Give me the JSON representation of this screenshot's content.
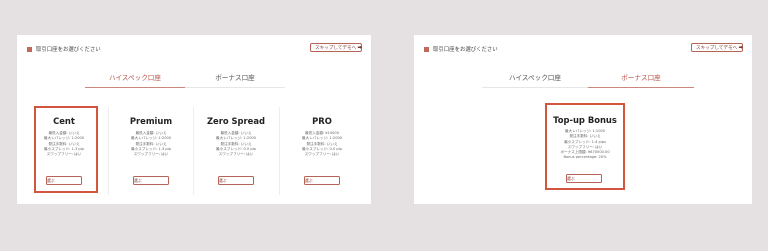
{
  "left": {
    "header_title": "取引口座をお選びください",
    "skip_label": "スキップしてデモへ ⮕",
    "tabs": [
      {
        "label": "ハイスペック口座",
        "active": true
      },
      {
        "label": "ボーナス口座",
        "active": false
      }
    ],
    "cards": [
      {
        "title": "Cent",
        "lines": [
          "最低入金額: いいえ",
          "最大レバレッジ: 1:2000",
          "発注手数料: いいえ",
          "最小スプレッド: 1.3 pip",
          "スワップフリー: はい"
        ],
        "button": "選ぶ",
        "highlighted": true
      },
      {
        "title": "Premium",
        "lines": [
          "最低入金額: いいえ",
          "最大レバレッジ: 1:2000",
          "発注手数料: いいえ",
          "最小スプレッド: 1.3 pip",
          "スワップフリー: はい"
        ],
        "button": "選ぶ",
        "highlighted": false
      },
      {
        "title": "Zero Spread",
        "lines": [
          "最低入金額: いいえ",
          "最大レバレッジ: 1:2000",
          "発注手数料: いいえ",
          "最小スプレッド: 0.0 pip",
          "スワップフリー: はい"
        ],
        "button": "選ぶ",
        "highlighted": false
      },
      {
        "title": "PRO",
        "lines": [
          "最低入金額: ¥10000",
          "最大レバレッジ: 1:2000",
          "発注手数料: いいえ",
          "最小スプレッド: 0.0 pip",
          "スワップフリー: はい"
        ],
        "button": "選ぶ",
        "highlighted": false
      }
    ]
  },
  "right": {
    "header_title": "取引口座をお選びください",
    "skip_label": "スキップしてデモへ ⮕",
    "tabs": [
      {
        "label": "ハイスペック口座",
        "active": false
      },
      {
        "label": "ボーナス口座",
        "active": true
      }
    ],
    "card": {
      "title": "Top-up Bonus",
      "lines": [
        "最大レバレッジ: 1:1000",
        "発注手数料: いいえ",
        "最小スプレッド: 1.4 pips",
        "スワップフリー: はい",
        "ボーナス上限額: ¥670000.00",
        "Bonus percentage: 20%"
      ],
      "button": "選ぶ",
      "highlighted": true
    }
  },
  "colors": {
    "accent": "#b5544a",
    "highlight": "#d2553f",
    "background": "#e5e0e1"
  }
}
